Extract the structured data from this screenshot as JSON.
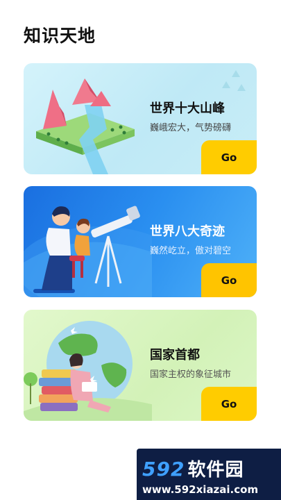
{
  "page": {
    "title": "知识天地"
  },
  "cards": [
    {
      "title": "世界十大山峰",
      "subtitle": "巍峨宏大，气势磅礴",
      "button": "Go"
    },
    {
      "title": "世界八大奇迹",
      "subtitle": "巍然屹立，傲对碧空",
      "button": "Go"
    },
    {
      "title": "国家首都",
      "subtitle": "国家主权的象征城市",
      "button": "Go"
    }
  ],
  "watermark": {
    "logo_num": "592",
    "logo_text": "软件园",
    "url": "www.592xiazai.com"
  },
  "colors": {
    "go_button": "#ffcc00",
    "card1_bg": "#c8edf7",
    "card2_bg": "#2a8ff0",
    "card3_bg": "#d8f4c0"
  }
}
